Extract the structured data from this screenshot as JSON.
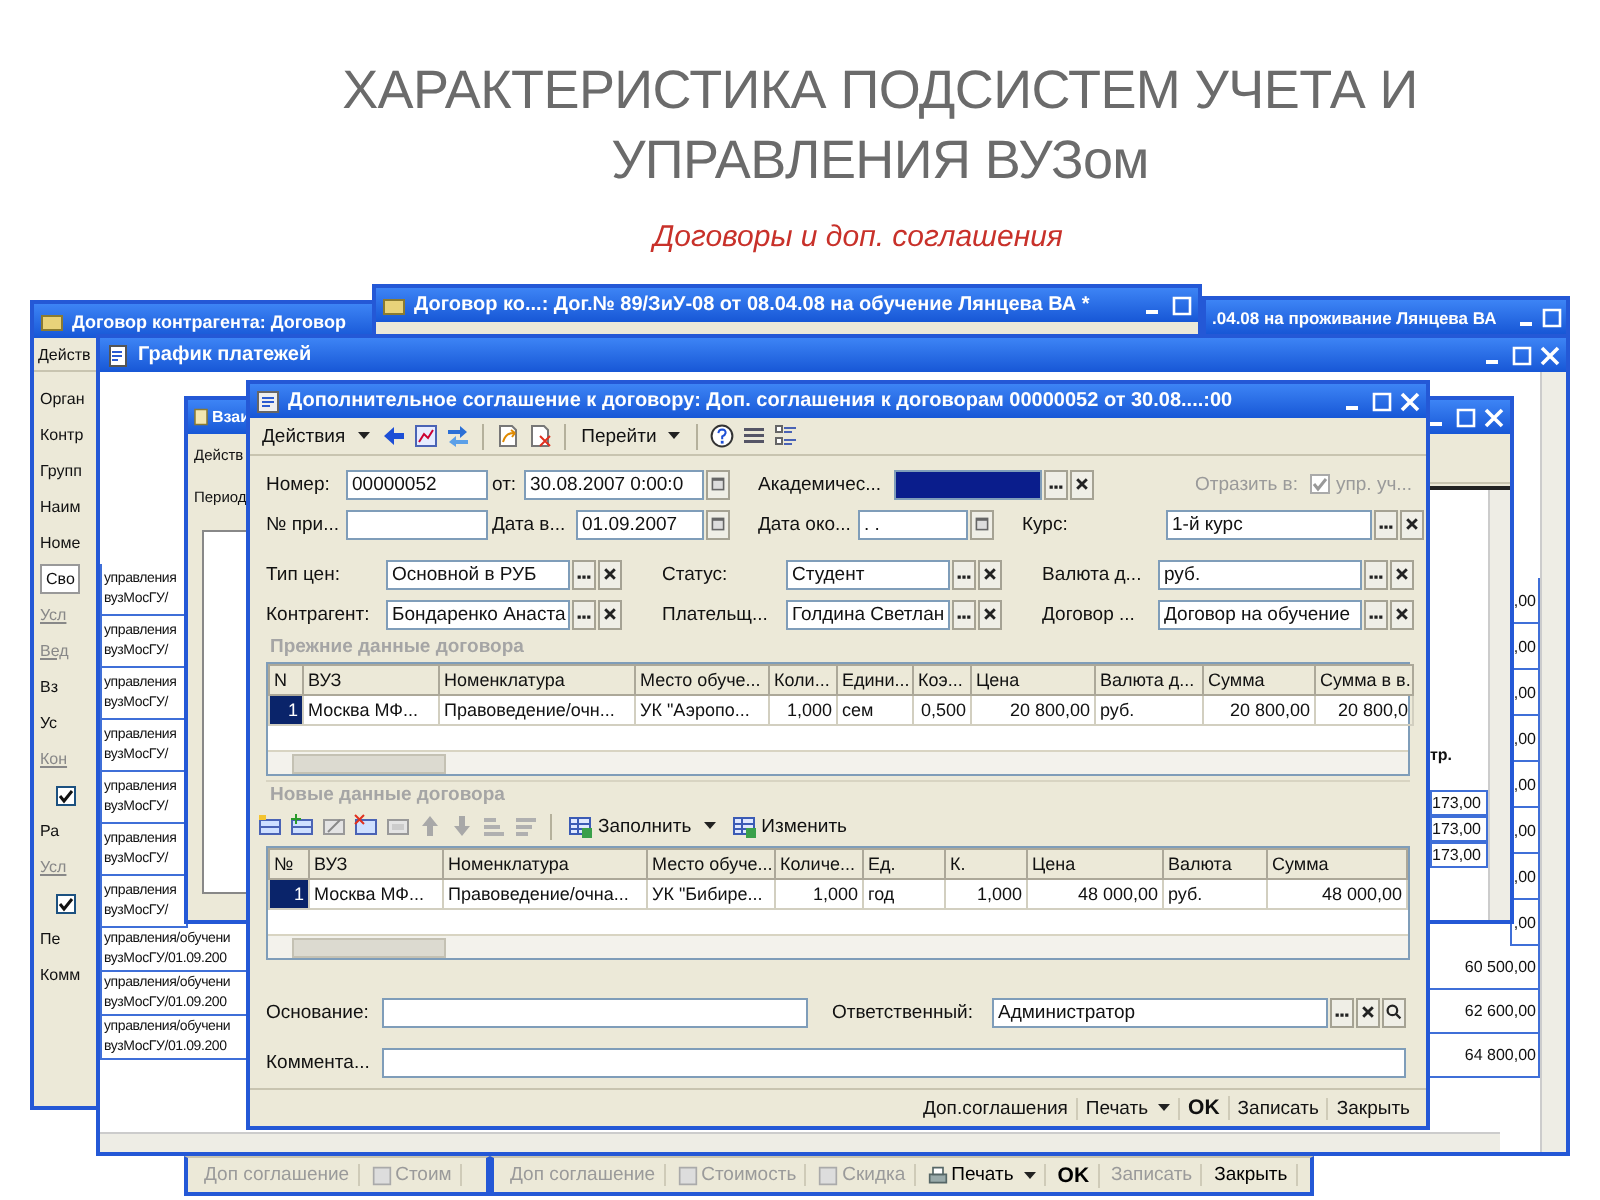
{
  "slide": {
    "title_lines": [
      "ХАРАКТЕРИСТИКА ПОДСИСТЕМ УЧЕТА И",
      "УПРАВЛЕНИЯ ВУЗом"
    ],
    "subtitle": "Договоры и доп. соглашения"
  },
  "footer_bars": [
    {
      "items": [
        {
          "kind": "text",
          "text": "Доп соглашение",
          "disabled": true
        },
        {
          "kind": "sheet",
          "text": "Стоим",
          "disabled": true
        }
      ]
    },
    {
      "items": [
        {
          "kind": "text",
          "text": "Доп соглашение",
          "disabled": true
        },
        {
          "kind": "sheet",
          "text": "Стоимость",
          "disabled": true
        },
        {
          "kind": "sheet",
          "text": "Скидка",
          "disabled": true
        },
        {
          "kind": "print",
          "text": "Печать",
          "disabled": false
        },
        {
          "kind": "default",
          "text": "OK",
          "disabled": false
        },
        {
          "kind": "text",
          "text": "Записать",
          "disabled": true
        },
        {
          "kind": "text",
          "text": "Закрыть",
          "disabled": false
        }
      ]
    }
  ],
  "contract_window": {
    "title": "Договор контрагента: Договор",
    "menu": "Действ",
    "items": [
      {
        "kind": "label",
        "text": "Орган"
      },
      {
        "kind": "label",
        "text": "Контр"
      },
      {
        "kind": "label",
        "text": "Групп"
      },
      {
        "kind": "label",
        "text": "Наим"
      },
      {
        "kind": "label",
        "text": "Номе"
      },
      {
        "kind": "tab",
        "text": "Сво"
      },
      {
        "kind": "section",
        "text": "Усл"
      },
      {
        "kind": "section",
        "text": "Вед"
      },
      {
        "kind": "label",
        "text": "Вз"
      },
      {
        "kind": "label",
        "text": "Ус"
      },
      {
        "kind": "section",
        "text": "Кон"
      },
      {
        "kind": "checkbox",
        "checked": true
      },
      {
        "kind": "label",
        "text": "Ра"
      },
      {
        "kind": "section",
        "text": "Усл"
      },
      {
        "kind": "checkbox",
        "checked": true
      },
      {
        "kind": "label",
        "text": "Пе"
      },
      {
        "kind": "label",
        "text": "Комм"
      }
    ]
  },
  "study_contract_window": {
    "title": "Договор ко...: Дог.№ 89/ЗиУ-08 от 08.04.08 на обучение Лянцева ВА *"
  },
  "housing_contract_window": {
    "title": ".04.08 на проживание Лянцева ВА"
  },
  "schedule_window": {
    "title": "График платежей",
    "left_rows_upper": [
      {
        "line_1": "управления",
        "line_2": "вузМосГУ/"
      },
      {
        "line_1": "управления",
        "line_2": "вузМосГУ/"
      },
      {
        "line_1": "управления",
        "line_2": "вузМосГУ/"
      },
      {
        "line_1": "управления",
        "line_2": "вузМосГУ/"
      },
      {
        "line_1": "управления",
        "line_2": "вузМосГУ/"
      },
      {
        "line_1": "управления",
        "line_2": "вузМосГУ/"
      },
      {
        "line_1": "управления",
        "line_2": "вузМосГУ/"
      }
    ],
    "left_rows_lower": [
      {
        "line_1": "управления/обучени",
        "line_2": "вузМосГУ/01.09.200"
      },
      {
        "line_1": "управления/обучени",
        "line_2": "вузМосГУ/01.09.200"
      },
      {
        "line_1": "управления/обучени",
        "line_2": "вузМосГУ/01.09.200"
      }
    ],
    "right_cells_upper": [
      ",00",
      ",00",
      ",00",
      ",00",
      ",00",
      ",00",
      ",00",
      ",00"
    ],
    "right_cells_lower": [
      "60 500,00",
      "62 600,00",
      "64 800,00"
    ]
  },
  "covered_window": {
    "title": "Взаи",
    "menu": "Действ",
    "period_label": "Период",
    "side_header": "тр.",
    "side_cells": [
      "173,00",
      "173,00",
      "173,00"
    ]
  },
  "agreement_window": {
    "title": "Дополнительное соглашение к договору: Доп. соглашения к договорам 00000052 от 30.08....:00",
    "toolbar": [
      {
        "kind": "menu",
        "text": "Действия"
      },
      {
        "kind": "menu",
        "text": "Перейти"
      }
    ],
    "form_rows": [
      [
        {
          "label": "Номер:",
          "kind": "text",
          "value": "00000052"
        },
        {
          "label": "от:",
          "kind": "date",
          "value": "30.08.2007 0:00:0"
        },
        {
          "label": "Академичес...",
          "kind": "ref",
          "highlighted": true
        },
        {
          "label": "Отразить в:",
          "kind": "check",
          "checked": true,
          "disabled": true,
          "text": "упр. уч..."
        }
      ],
      [
        {
          "label": "№ при...",
          "kind": "text"
        },
        {
          "label": "Дата в...",
          "kind": "date",
          "value": "01.09.2007"
        },
        {
          "label": "Дата око...",
          "kind": "date",
          "value": ". ."
        },
        {
          "label": "Курс:",
          "kind": "ref",
          "value": "1-й курс"
        }
      ],
      [
        {
          "label": "Тип цен:",
          "kind": "ref",
          "value": "Основной в РУБ"
        },
        {
          "label": "Статус:",
          "kind": "ref",
          "value": "Студент"
        },
        {
          "label": "Валюта д...",
          "kind": "ref",
          "value": "руб."
        }
      ],
      [
        {
          "label": "Контрагент:",
          "kind": "ref",
          "value": "Бондаренко Анаста"
        },
        {
          "label": "Плательщ...",
          "kind": "ref",
          "value": "Голдина Светлан"
        },
        {
          "label": "Договор ...",
          "kind": "ref",
          "value": "Договор на обучение"
        }
      ]
    ],
    "old_contract": {
      "heading": "Прежние данные договора",
      "columns": [
        "N",
        "ВУЗ",
        "Номенклатура",
        "Место обуче...",
        "Коли...",
        "Едини...",
        "Коэ...",
        "Цена",
        "Валюта д...",
        "Сумма",
        "Сумма в в."
      ],
      "rows": [
        {
          "selected": true,
          "cells": [
            "1",
            "Москва МФ...",
            "Правоведение/очн...",
            "УК \"Аэропо...",
            "1,000",
            "сем",
            "0,500",
            "20 800,00",
            "руб.",
            "20 800,00",
            "20 800,0"
          ]
        }
      ]
    },
    "new_contract": {
      "heading": "Новые данные договора",
      "toolbar": [
        {
          "kind": "menu",
          "text": "Заполнить"
        },
        {
          "kind": "text",
          "text": "Изменить"
        }
      ],
      "columns": [
        "№",
        "ВУЗ",
        "Номенклатура",
        "Место обуче...",
        "Количе...",
        "Ед.",
        "К.",
        "Цена",
        "Валюта",
        "Сумма"
      ],
      "rows": [
        {
          "selected": true,
          "cells": [
            "1",
            "Москва МФ...",
            "Правоведение/очна...",
            "УК \"Бибире...",
            "1,000",
            "год",
            "1,000",
            "48 000,00",
            "руб.",
            "48 000,00"
          ]
        }
      ]
    },
    "bottom_rows": [
      [
        {
          "label": "Основание:",
          "kind": "text"
        },
        {
          "label": "Ответственный:",
          "kind": "ref_search",
          "value": "Администратор"
        }
      ],
      [
        {
          "label": "Коммента...",
          "kind": "text"
        }
      ]
    ],
    "footer": [
      {
        "kind": "text",
        "text": "Доп.соглашения",
        "disabled": false
      },
      {
        "kind": "menu",
        "text": "Печать",
        "disabled": false
      },
      {
        "kind": "default",
        "text": "OK",
        "disabled": false
      },
      {
        "kind": "text",
        "text": "Записать",
        "disabled": false
      },
      {
        "kind": "text",
        "text": "Закрыть",
        "disabled": false
      }
    ]
  }
}
